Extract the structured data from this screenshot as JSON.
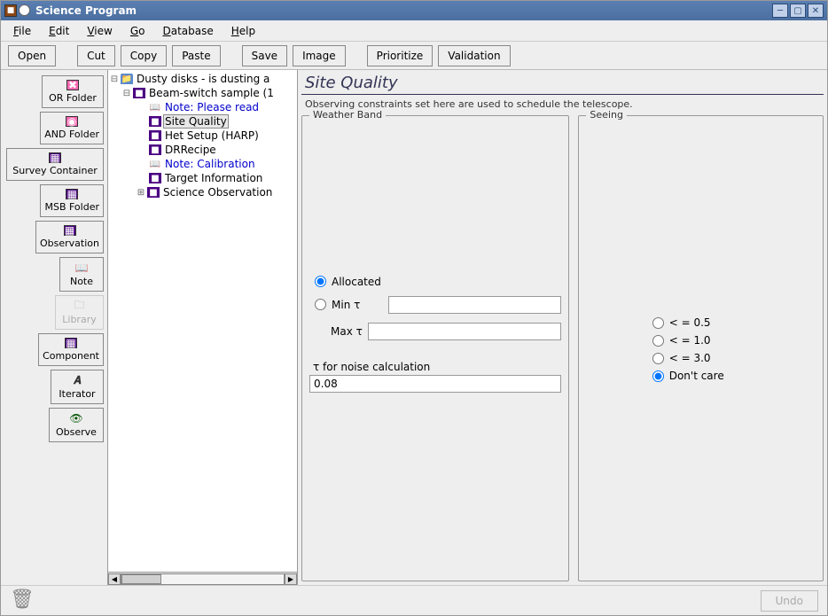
{
  "window": {
    "title": "Science Program"
  },
  "menu": [
    "File",
    "Edit",
    "View",
    "Go",
    "Database",
    "Help"
  ],
  "toolbar": {
    "open": "Open",
    "cut": "Cut",
    "copy": "Copy",
    "paste": "Paste",
    "save": "Save",
    "image": "Image",
    "prioritize": "Prioritize",
    "validation": "Validation"
  },
  "sidebar": {
    "or_folder": "OR Folder",
    "and_folder": "AND Folder",
    "survey_container": "Survey Container",
    "msb_folder": "MSB Folder",
    "observation": "Observation",
    "note": "Note",
    "library": "Library",
    "component": "Component",
    "iterator": "Iterator",
    "observe": "Observe"
  },
  "tree": {
    "root": "Dusty disks - is dusting a",
    "child": "Beam-switch sample (1",
    "items": [
      "Note: Please read",
      "Site Quality",
      "Het Setup (HARP)",
      "DRRecipe",
      "Note: Calibration",
      "Target Information",
      "Science Observation"
    ]
  },
  "panel": {
    "title": "Site Quality",
    "desc": "Observing constraints set here are used to schedule the telescope.",
    "weather_band": {
      "legend": "Weather Band",
      "allocated": "Allocated",
      "min_tau": "Min τ",
      "max_tau": "Max τ",
      "min_tau_value": "",
      "max_tau_value": "",
      "tau_noise_label": "τ for noise calculation",
      "tau_noise_value": "0.08"
    },
    "seeing": {
      "legend": "Seeing",
      "options": [
        "< = 0.5",
        "< = 1.0",
        "< = 3.0",
        "Don't care"
      ],
      "selected": "Don't care"
    }
  },
  "footer": {
    "undo": "Undo"
  }
}
